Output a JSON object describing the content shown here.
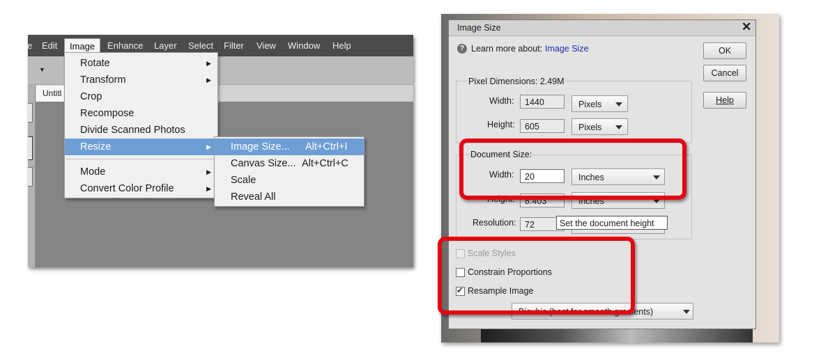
{
  "left": {
    "menubar": [
      "e",
      "Edit",
      "Image",
      "Enhance",
      "Layer",
      "Select",
      "Filter",
      "View",
      "Window",
      "Help"
    ],
    "doc_tab": "Untitl",
    "image_menu": {
      "items": [
        {
          "label": "Rotate",
          "submenu": true
        },
        {
          "label": "Transform",
          "submenu": true
        },
        {
          "label": "Crop",
          "submenu": false
        },
        {
          "label": "Recompose",
          "submenu": false
        },
        {
          "label": "Divide Scanned Photos",
          "submenu": false
        },
        {
          "label": "Resize",
          "submenu": true,
          "selected": true
        },
        {
          "label": "Mode",
          "submenu": true
        },
        {
          "label": "Convert Color Profile",
          "submenu": true
        }
      ]
    },
    "resize_submenu": {
      "items": [
        {
          "label": "Image Size...",
          "shortcut": "Alt+Ctrl+I",
          "selected": true
        },
        {
          "label": "Canvas Size...",
          "shortcut": "Alt+Ctrl+C"
        },
        {
          "label": "Scale",
          "shortcut": ""
        },
        {
          "label": "Reveal All",
          "shortcut": ""
        }
      ]
    }
  },
  "dialog": {
    "title": "Image Size",
    "close_glyph": "✕",
    "help_glyph": "?",
    "learn_more": "Learn more about:",
    "learn_link": "Image Size",
    "buttons": {
      "ok": "OK",
      "cancel": "Cancel",
      "help": "Help"
    },
    "pixel_dimensions": {
      "label": "Pixel Dimensions:  2.49M",
      "width_label": "Width:",
      "width_value": "1440",
      "width_unit": "Pixels",
      "height_label": "Height:",
      "height_value": "605",
      "height_unit": "Pixels"
    },
    "document_size": {
      "label": "Document Size:",
      "width_label": "Width:",
      "width_value": "20",
      "width_unit": "Inches",
      "height_label": "Height:",
      "height_value": "8.403",
      "height_unit": "Inches",
      "resolution_label": "Resolution:",
      "resolution_value": "72"
    },
    "tooltip": "Set the document height",
    "checkboxes": [
      {
        "label": "Scale Styles",
        "checked": false,
        "disabled": true
      },
      {
        "label": "Constrain Proportions",
        "checked": false,
        "disabled": false
      },
      {
        "label": "Resample Image",
        "checked": true,
        "disabled": false
      }
    ],
    "resample_method": "Bicubic (best for smooth gradients)"
  },
  "colors": {
    "highlight": "#e30613",
    "menu_selection": "#6f9ed6",
    "link": "#1c30b0"
  }
}
